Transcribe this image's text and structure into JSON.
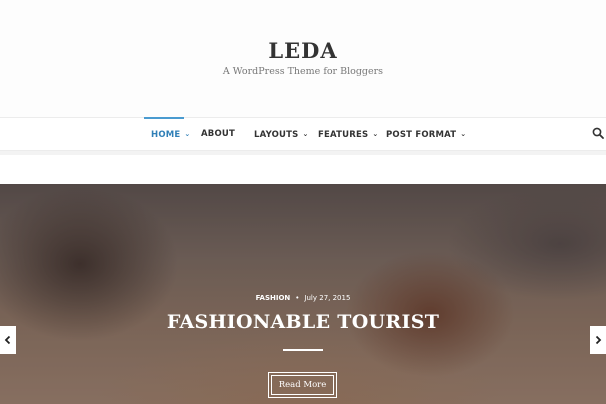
{
  "site": {
    "title": "LEDA",
    "tagline": "A WordPress Theme for Bloggers"
  },
  "nav": {
    "items": [
      {
        "label": "HOME",
        "has_dropdown": true,
        "active": true
      },
      {
        "label": "ABOUT",
        "has_dropdown": false,
        "active": false
      },
      {
        "label": "LAYOUTS",
        "has_dropdown": true,
        "active": false
      },
      {
        "label": "FEATURES",
        "has_dropdown": true,
        "active": false
      },
      {
        "label": "POST FORMAT",
        "has_dropdown": true,
        "active": false
      }
    ],
    "search_icon": "search-icon",
    "accent_color": "#2f7fb7"
  },
  "slider": {
    "category": "FASHION",
    "date": "July 27, 2015",
    "title": "FASHIONABLE TOURIST",
    "button_label": "Read More",
    "prev_icon": "chevron-left-icon",
    "next_icon": "chevron-right-icon"
  }
}
